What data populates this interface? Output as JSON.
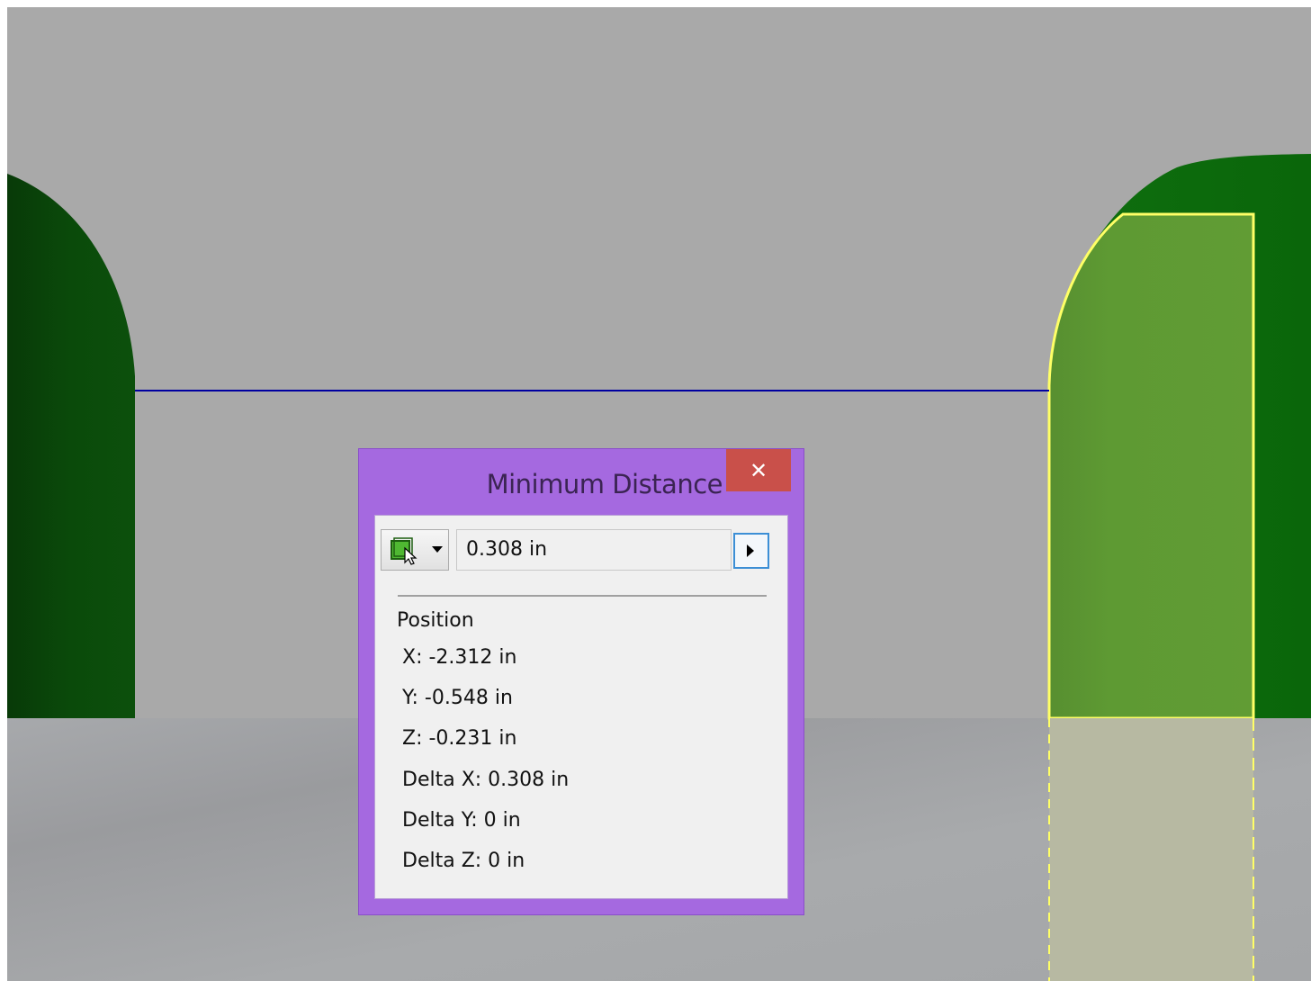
{
  "dialog": {
    "title": "Minimum Distance",
    "close_symbol": "✕",
    "pick_icon": "select-geometry-icon",
    "distance_value": "0.308 in",
    "position_heading": "Position",
    "x": "X: -2.312 in",
    "y": "Y: -0.548 in",
    "z": "Z: -0.231 in",
    "delta_x": "Delta X: 0.308 in",
    "delta_y": "Delta Y: 0 in",
    "delta_z": "Delta Z: 0 in"
  },
  "colors": {
    "background": "#a9a9a9",
    "floor": "#a3a5a8",
    "left_part": "#0b4b0b",
    "right_part": "#0b6b0b",
    "selected_face": "#5f9a33",
    "selection_edge": "#ffff66",
    "measure_line": "#0000a0",
    "dialog_frame": "#a569e0",
    "close_button": "#c9504a"
  }
}
